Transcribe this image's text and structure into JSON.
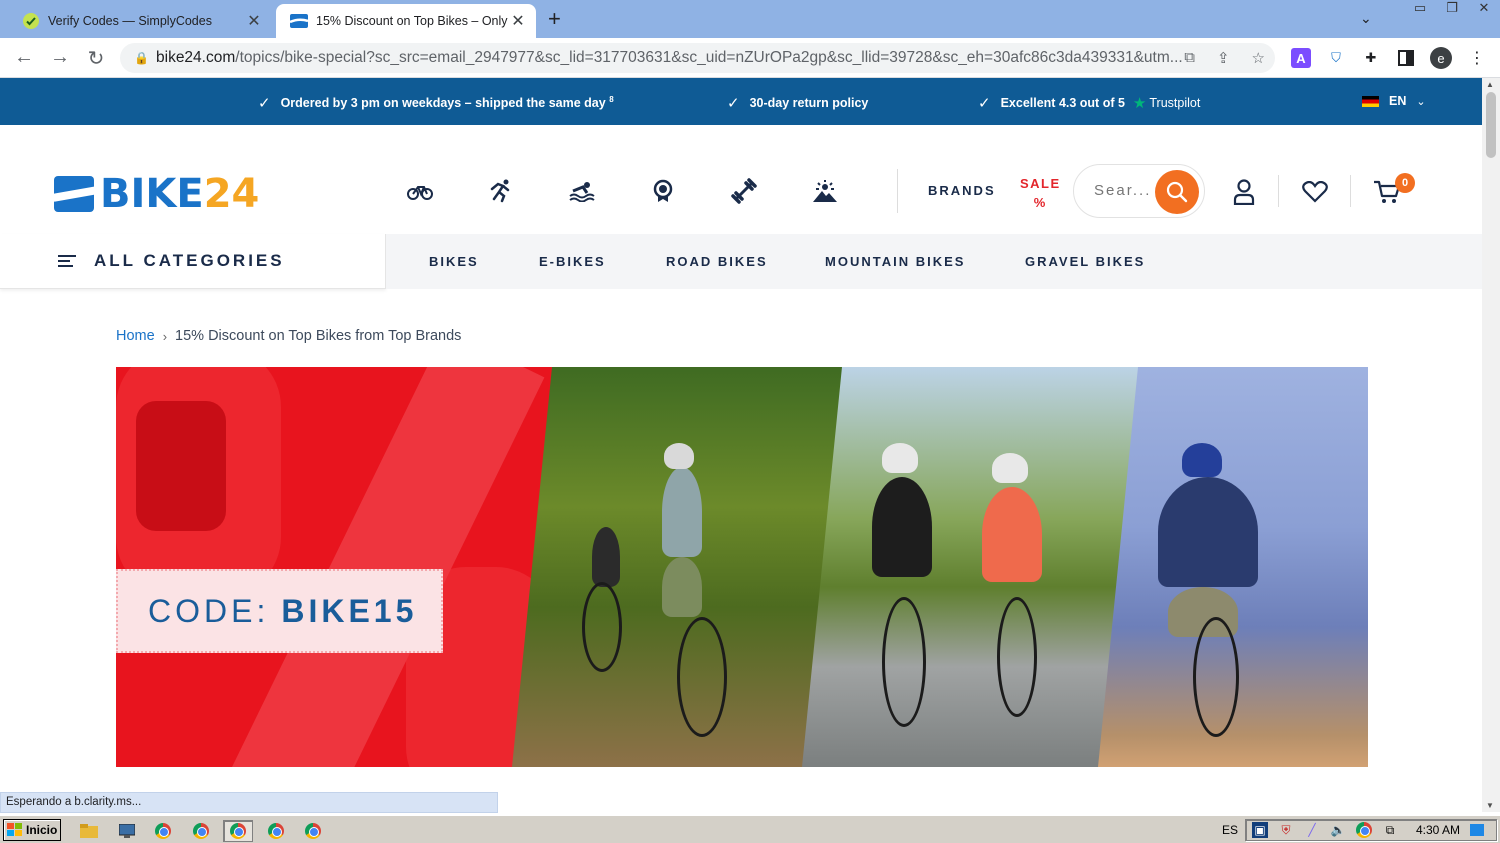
{
  "browser": {
    "tabs": [
      {
        "title": "Verify Codes — SimplyCodes",
        "active": false
      },
      {
        "title": "15% Discount on Top Bikes – Only I",
        "active": true
      }
    ],
    "url_host": "bike24.com",
    "url_rest": "/topics/bike-special?sc_src=email_2947977&sc_lid=317703631&sc_uid=nZUrOPa2gp&sc_llid=39728&sc_eh=30afc86c3da439331&utm...",
    "profile_initial": "e",
    "status_text": "Esperando a b.clarity.ms..."
  },
  "promo_bar": {
    "items": [
      {
        "text": "Ordered by 3 pm on weekdays – shipped the same day",
        "sup": "8"
      },
      {
        "text": "30-day return policy"
      },
      {
        "text": "Excellent 4.3 out of 5",
        "trustpilot": "Trustpilot"
      }
    ],
    "language": "EN"
  },
  "header": {
    "logo": {
      "text": "BIKE",
      "accent": "24"
    },
    "category_icons": [
      "bike-icon",
      "running-icon",
      "swimming-icon",
      "triathlon-medal-icon",
      "fitness-dumbbell-icon",
      "outdoor-mountain-icon"
    ],
    "brands_label": "BRANDS",
    "sale_label": "SALE",
    "sale_symbol": "%",
    "search_placeholder": "Sear...",
    "cart_count": "0"
  },
  "nav": {
    "all_categories": "ALL CATEGORIES",
    "links": [
      "BIKES",
      "E-BIKES",
      "ROAD BIKES",
      "MOUNTAIN BIKES",
      "GRAVEL BIKES"
    ]
  },
  "breadcrumb": {
    "home": "Home",
    "current": "15% Discount on Top Bikes from Top Brands"
  },
  "banner": {
    "code_label": "CODE:",
    "code_value": "BIKE15"
  },
  "taskbar": {
    "start_label": "Inicio",
    "language": "ES",
    "clock": "4:30 AM"
  },
  "colors": {
    "promo_blue": "#0f5b95",
    "brand_blue": "#1a73c8",
    "accent_orange": "#f26f21",
    "sale_red": "#e3262c",
    "banner_red": "#e8141e"
  }
}
